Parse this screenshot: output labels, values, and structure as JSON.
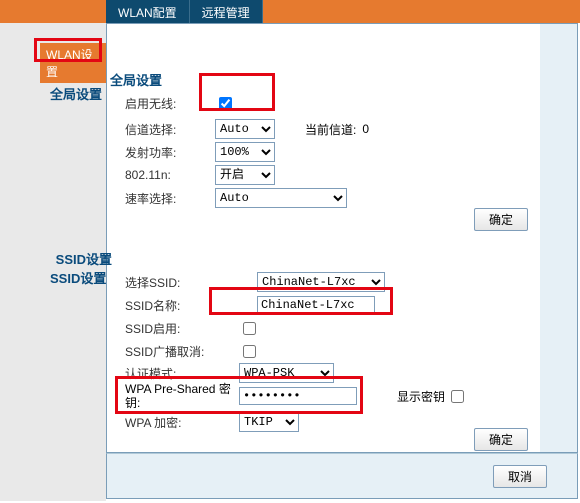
{
  "tabs": {
    "wlan_config": "WLAN配置",
    "remote_mgmt": "远程管理"
  },
  "sidebar": {
    "wlan_settings": "WLAN设置"
  },
  "global_section": {
    "title": "全局设置",
    "enable_wireless_label": "启用无线:",
    "channel_label": "信道选择:",
    "channel_value": "Auto",
    "current_channel_label": "当前信道:",
    "current_channel_value": "0",
    "tx_power_label": "发射功率:",
    "tx_power_value": "100%",
    "mode_label": "802.11n:",
    "mode_value": "开启",
    "rate_label": "速率选择:",
    "rate_value": "Auto",
    "confirm": "确定"
  },
  "ssid_section": {
    "title": "SSID设置",
    "select_ssid_label": "选择SSID:",
    "select_ssid_value": "ChinaNet-L7xc",
    "ssid_name_label": "SSID名称:",
    "ssid_name_value": "ChinaNet-L7xc",
    "ssid_enable_label": "SSID启用:",
    "ssid_bcast_label": "SSID广播取消:",
    "auth_mode_label": "认证模式:",
    "auth_mode_value": "WPA-PSK",
    "wpa_key_label1": "WPA Pre-Shared 密",
    "wpa_key_label2": "钥:",
    "wpa_key_value": "••••••••",
    "show_key_label": "显示密钥",
    "wpa_enc_label": "WPA 加密:",
    "wpa_enc_value": "TKIP",
    "confirm": "确定"
  },
  "footer": {
    "cancel": "取消"
  }
}
